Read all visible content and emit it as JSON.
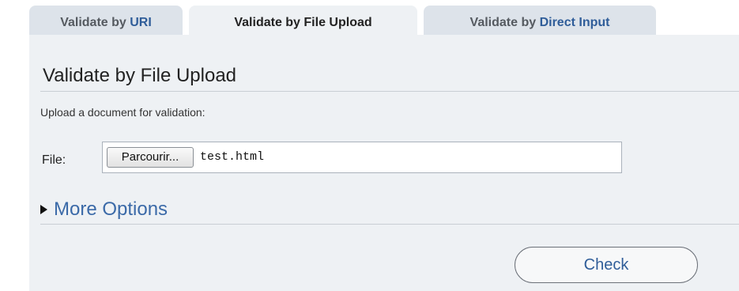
{
  "tabs": {
    "uri": {
      "prefix": "Validate by ",
      "highlight": "URI"
    },
    "upload": {
      "prefix": "Validate by ",
      "highlight": "File Upload"
    },
    "direct": {
      "prefix": "Validate by ",
      "highlight": "Direct Input"
    },
    "active": "upload"
  },
  "panel": {
    "title": "Validate by File Upload",
    "instructions": "Upload a document for validation:",
    "file_label": "File:",
    "browse_label": "Parcourir...",
    "file_name": "test.html",
    "more_options": "More Options",
    "check_label": "Check"
  },
  "colors": {
    "tab_inactive_bg": "#dde3ea",
    "panel_bg": "#eef1f4",
    "link_blue": "#3b6aa8"
  },
  "icons": {
    "expander": "triangle-right-icon"
  }
}
